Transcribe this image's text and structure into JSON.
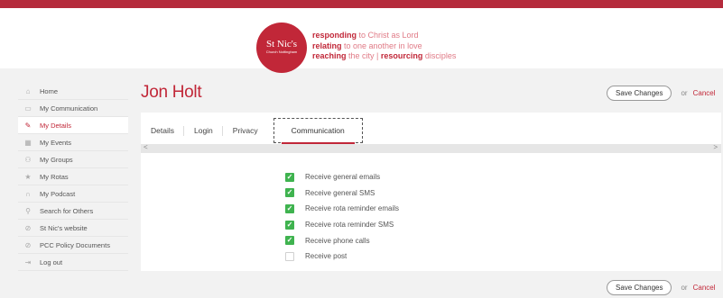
{
  "header": {
    "logo": {
      "line1": "St Nic's",
      "line2": "Church Nottingham"
    },
    "tagline": [
      {
        "bold": "responding",
        "rest": " to Christ as Lord"
      },
      {
        "bold": "relating",
        "rest": " to one another in love"
      },
      {
        "bold": "reaching",
        "mid": " the city | ",
        "bold2": "resourcing",
        "rest": " disciples"
      }
    ]
  },
  "sidebar": {
    "items": [
      {
        "label": "Home",
        "icon": "home-icon",
        "glyph": "⌂"
      },
      {
        "label": "My Communication",
        "icon": "comment-icon",
        "glyph": "▭"
      },
      {
        "label": "My Details",
        "icon": "pencil-icon",
        "glyph": "✎"
      },
      {
        "label": "My Events",
        "icon": "calendar-icon",
        "glyph": "▦"
      },
      {
        "label": "My Groups",
        "icon": "group-icon",
        "glyph": "⚇"
      },
      {
        "label": "My Rotas",
        "icon": "star-icon",
        "glyph": "★"
      },
      {
        "label": "My Podcast",
        "icon": "headphones-icon",
        "glyph": "∩"
      },
      {
        "label": "Search for Others",
        "icon": "search-people-icon",
        "glyph": "⚲"
      },
      {
        "label": "St Nic's website",
        "icon": "link-icon",
        "glyph": "⊘"
      },
      {
        "label": "PCC Policy Documents",
        "icon": "link-icon",
        "glyph": "⊘"
      },
      {
        "label": "Log out",
        "icon": "logout-icon",
        "glyph": "⇥"
      }
    ],
    "active_index": 2
  },
  "page": {
    "title": "Jon Holt",
    "save_label": "Save Changes",
    "or_label": "or",
    "cancel_label": "Cancel"
  },
  "tabs": {
    "items": [
      "Details",
      "Login",
      "Privacy",
      "Communication"
    ],
    "active": "Communication"
  },
  "scroll": {
    "left_glyph": "<",
    "right_glyph": ">"
  },
  "communication": {
    "options": [
      {
        "label": "Receive general emails",
        "checked": true
      },
      {
        "label": "Receive general SMS",
        "checked": true
      },
      {
        "label": "Receive rota reminder emails",
        "checked": true
      },
      {
        "label": "Receive rota reminder SMS",
        "checked": true
      },
      {
        "label": "Receive phone calls",
        "checked": true
      },
      {
        "label": "Receive post",
        "checked": false
      }
    ],
    "check_glyph": "✓"
  },
  "colors": {
    "brand": "#c12738",
    "stripe": "#b52b3c",
    "checkbox_on": "#3fb34f"
  }
}
